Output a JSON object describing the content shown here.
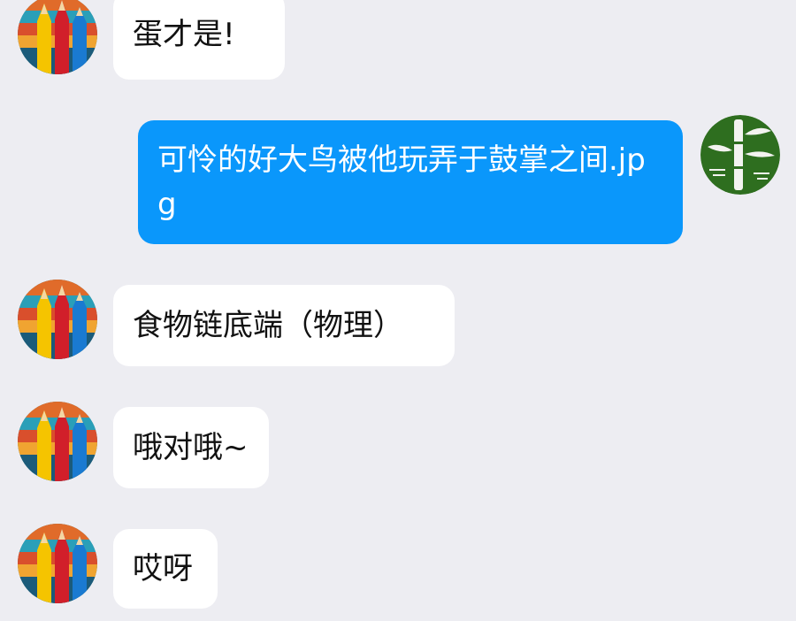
{
  "messages": [
    {
      "side": "in",
      "avatar": "pencils-avatar",
      "text": "蛋才是!"
    },
    {
      "side": "out",
      "avatar": "bamboo-avatar",
      "text": "可怜的好大鸟被他玩弄于鼓掌之间.jpg"
    },
    {
      "side": "in",
      "avatar": "pencils-avatar",
      "text": "食物链底端（物理）"
    },
    {
      "side": "in",
      "avatar": "pencils-avatar",
      "text": "哦对哦~"
    },
    {
      "side": "in",
      "avatar": "pencils-avatar",
      "text": "哎呀"
    }
  ],
  "colors": {
    "background": "#ededf2",
    "incoming_bubble": "#ffffff",
    "outgoing_bubble": "#0a97fb",
    "bamboo_green": "#2e6e1f"
  }
}
